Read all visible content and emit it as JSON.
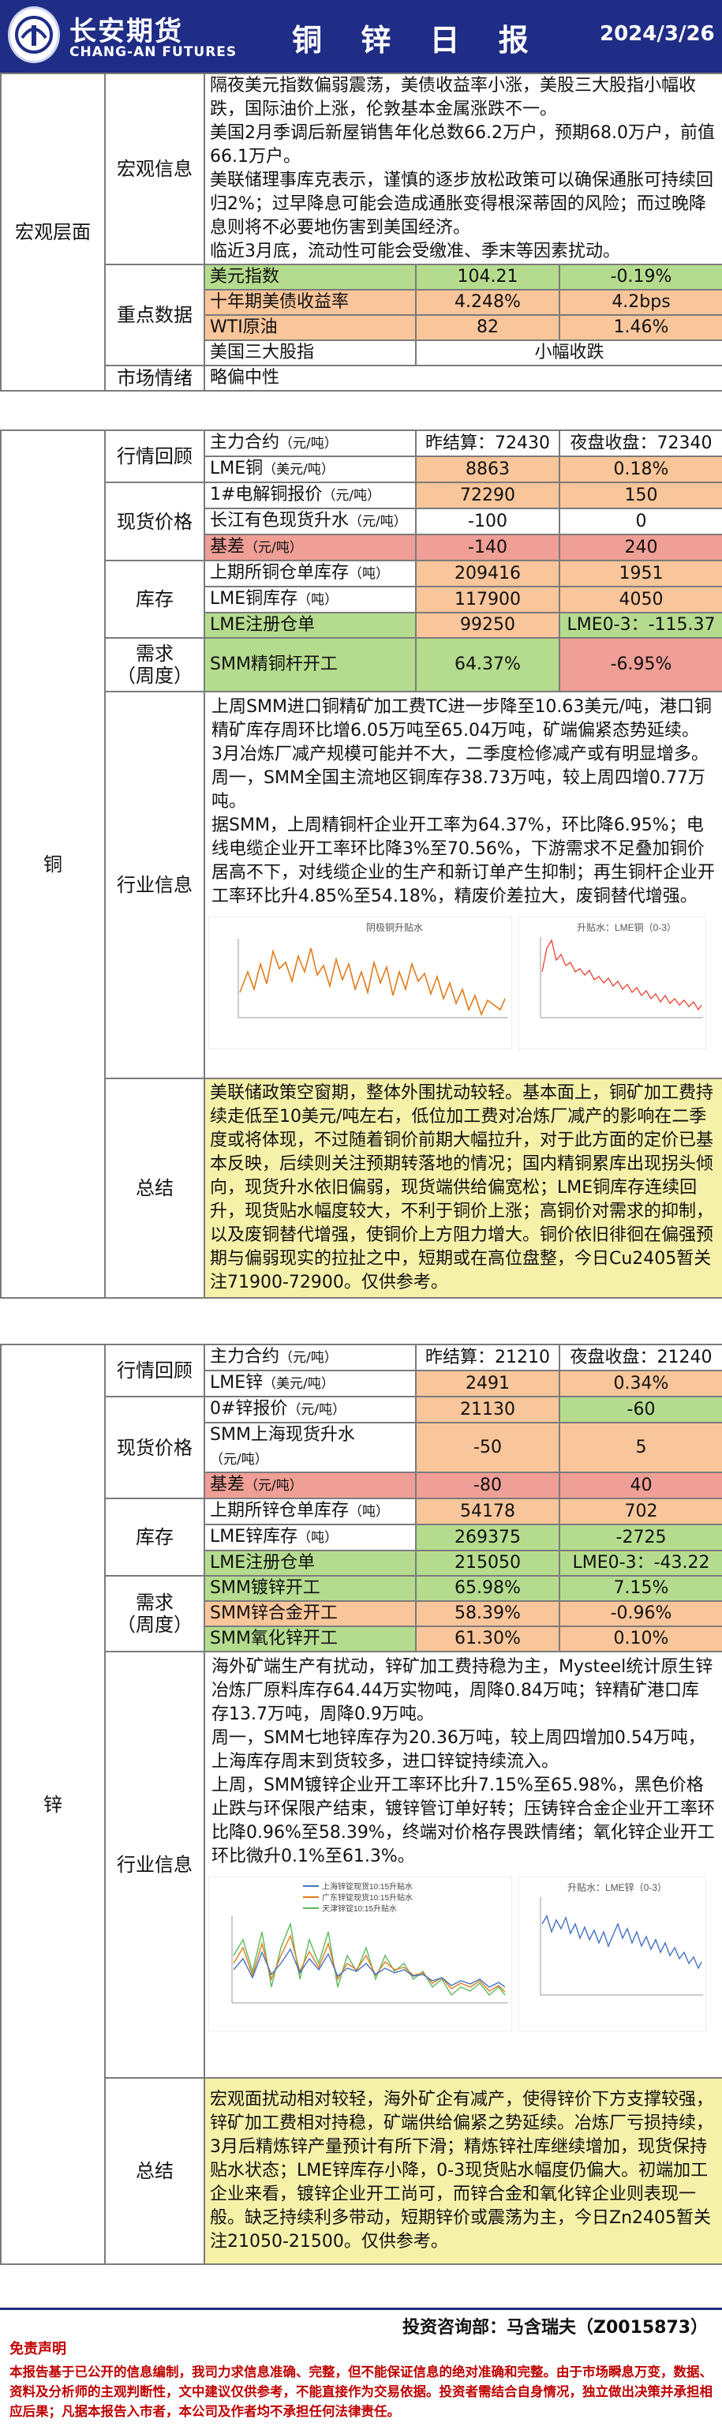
{
  "header": {
    "company_cn": "长安期货",
    "company_en": "CHANG-AN FUTURES",
    "title": "铜 锌 日 报",
    "date": "2024/3/26",
    "brand_color": "#1f2d86"
  },
  "macro": {
    "section": "宏观层面",
    "info_label": "宏观信息",
    "info_text": "隔夜美元指数偏弱震荡，美债收益率小涨，美股三大股指小幅收跌，国际油价上涨，伦敦基本金属涨跌不一。\n美国2月季调后新屋销售年化总数66.2万户，预期68.0万户，前值66.1万户。\n美联储理事库克表示，谨慎的逐步放松政策可以确保通胀可持续回归2%；过早降息可能会造成通胀变得根深蒂固的风险；而过晚降息则将不必要地伤害到美国经济。\n临近3月底，流动性可能会受缴准、季末等因素扰动。",
    "key_label": "重点数据",
    "rows": [
      {
        "name": "美元指数",
        "v1": "104.21",
        "v2": "-0.19%"
      },
      {
        "name": "十年期美债收益率",
        "v1": "4.248%",
        "v2": "4.2bps"
      },
      {
        "name": "WTI原油",
        "v1": "82",
        "v2": "1.46%"
      },
      {
        "name": "美国三大股指",
        "v1": "小幅收跌",
        "v2": ""
      }
    ],
    "sentiment_label": "市场情绪",
    "sentiment_value": "略偏中性"
  },
  "copper": {
    "section": "铜",
    "quote_label": "行情回顾",
    "quote_rows": [
      {
        "name": "主力合约",
        "unit": "（元/吨）",
        "v1": "昨结算：72430",
        "v2": "夜盘收盘：72340"
      },
      {
        "name": "LME铜",
        "unit": "（美元/吨）",
        "v1": "8863",
        "v2": "0.18%"
      }
    ],
    "spot_label": "现货价格",
    "spot_rows": [
      {
        "name": "1#电解铜报价",
        "unit": "（元/吨）",
        "v1": "72290",
        "v2": "150"
      },
      {
        "name": "长江有色现货升水",
        "unit": "（元/吨）",
        "v1": "-100",
        "v2": "0"
      },
      {
        "name": "基差",
        "unit": "（元/吨）",
        "v1": "-140",
        "v2": "240"
      }
    ],
    "stock_label": "库存",
    "stock_rows": [
      {
        "name": "上期所铜仓单库存",
        "unit": "（吨）",
        "v1": "209416",
        "v2": "1951"
      },
      {
        "name": "LME铜库存",
        "unit": "（吨）",
        "v1": "117900",
        "v2": "4050"
      },
      {
        "name": "LME注册仓单",
        "unit": "",
        "v1": "99250",
        "v2": "LME0-3：-115.37"
      }
    ],
    "demand_label": "需求\n（周度）",
    "demand_rows": [
      {
        "name": "SMM精铜杆开工",
        "v1": "64.37%",
        "v2": "-6.95%"
      }
    ],
    "industry_label": "行业信息",
    "industry_text": "上周SMM进口铜精矿加工费TC进一步降至10.63美元/吨，港口铜精矿库存周环比增6.05万吨至65.04万吨，矿端偏紧态势延续。\n3月冶炼厂减产规模可能并不大，二季度检修减产或有明显增多。\n周一，SMM全国主流地区铜库存38.73万吨，较上周四增0.77万吨。\n据SMM，上周精铜杆企业开工率为64.37%，环比降6.95%；电线电缆企业开工率环比降3%至70.56%，下游需求不足叠加铜价居高不下，对线缆企业的生产和新订单产生抑制；再生铜杆企业开工率环比升4.85%至54.18%，精废价差拉大，废铜替代增强。",
    "chart_left_title": "阴极铜升贴水",
    "chart_right_title": "升贴水：LME铜（0-3）",
    "summary_label": "总结",
    "summary_text": "美联储政策空窗期，整体外围扰动较轻。基本面上，铜矿加工费持续走低至10美元/吨左右，低位加工费对冶炼厂减产的影响在二季度或将体现，不过随着铜价前期大幅拉升，对于此方面的定价已基本反映，后续则关注预期转落地的情况；国内精铜累库出现拐头倾向，现货升水依旧偏弱，现货端供给偏宽松；LME铜库存连续回升，现货贴水幅度较大，不利于铜价上涨；高铜价对需求的抑制，以及废铜替代增强，使铜价上方阻力增大。铜价依旧徘徊在偏强预期与偏弱现实的拉扯之中，短期或在高位盘整，今日Cu2405暂关注71900-72900。仅供参考。"
  },
  "zinc": {
    "section": "锌",
    "quote_label": "行情回顾",
    "quote_rows": [
      {
        "name": "主力合约",
        "unit": "（元/吨）",
        "v1": "昨结算：21210",
        "v2": "夜盘收盘：21240"
      },
      {
        "name": "LME锌",
        "unit": "（美元/吨）",
        "v1": "2491",
        "v2": "0.34%"
      }
    ],
    "spot_label": "现货价格",
    "spot_rows": [
      {
        "name": "0#锌报价",
        "unit": "（元/吨）",
        "v1": "21130",
        "v2": "-60"
      },
      {
        "name": "SMM上海现货升水",
        "unit": "（元/吨）",
        "v1": "-50",
        "v2": "5"
      },
      {
        "name": "基差",
        "unit": "（元/吨）",
        "v1": "-80",
        "v2": "40"
      }
    ],
    "stock_label": "库存",
    "stock_rows": [
      {
        "name": "上期所锌仓单库存",
        "unit": "（吨）",
        "v1": "54178",
        "v2": "702"
      },
      {
        "name": "LME锌库存",
        "unit": "（吨）",
        "v1": "269375",
        "v2": "-2725"
      },
      {
        "name": "LME注册仓单",
        "unit": "",
        "v1": "215050",
        "v2": "LME0-3：-43.22"
      }
    ],
    "demand_label": "需求\n（周度）",
    "demand_rows": [
      {
        "name": "SMM镀锌开工",
        "v1": "65.98%",
        "v2": "7.15%"
      },
      {
        "name": "SMM锌合金开工",
        "v1": "58.39%",
        "v2": "-0.96%"
      },
      {
        "name": "SMM氧化锌开工",
        "v1": "61.30%",
        "v2": "0.10%"
      }
    ],
    "industry_label": "行业信息",
    "industry_text": "海外矿端生产有扰动，锌矿加工费持稳为主，Mysteel统计原生锌冶炼厂原料库存64.44万实物吨，周降0.84万吨；锌精矿港口库存13.7万吨，周降0.9万吨。\n周一，SMM七地锌库存为20.36万吨，较上周四增加0.54万吨，上海库存周末到货较多，进口锌锭持续流入。\n上周，SMM镀锌企业开工率环比升7.15%至65.98%，黑色价格止跌与环保限产结束，镀锌管订单好转；压铸锌合金企业开工率环比降0.96%至58.39%，终端对价格存畏跌情绪；氧化锌企业开工环比微升0.1%至61.3%。",
    "chart_left_legend": [
      "上海锌锭现货10:15升贴水",
      "广东锌锭现货10:15升贴水",
      "天津锌锭10:15升贴水"
    ],
    "chart_right_title": "升贴水：LME锌（0-3）",
    "summary_label": "总结",
    "summary_text": "宏观面扰动相对较轻，海外矿企有减产，使得锌价下方支撑较强，锌矿加工费相对持稳，矿端供给偏紧之势延续。冶炼厂亏损持续，3月后精炼锌产量预计有所下滑；精炼锌社库继续增加，现货保持贴水状态；LME锌库存小降，0-3现货贴水幅度仍偏大。初端加工企业来看，镀锌企业开工尚可，而锌合金和氧化锌企业则表现一般。缺乏持续利多带动，短期锌价或震荡为主，今日Zn2405暂关注21050-21500。仅供参考。"
  },
  "footer": {
    "analyst": "投资咨询部：马含瑞夫（Z0015873）",
    "disclaimer_title": "免责声明",
    "disclaimer_text": "本报告基于已公开的信息编制，我司力求信息准确、完整，但不能保证信息的绝对准确和完整。由于市场瞬息万变，数据、资料及分析师的主观判断性，文中建议仅供参考，不能直接作为交易依据。投资者需结合自身情况，独立做出决策并承担相应后果；凡据本报告入市者，本公司及作者均不承担任何法律责任。"
  }
}
